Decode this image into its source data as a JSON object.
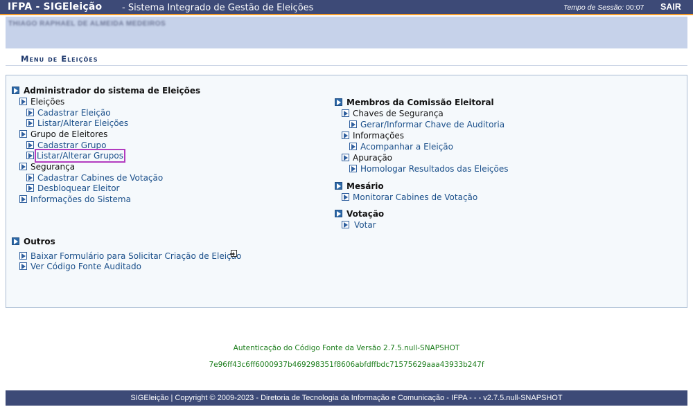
{
  "header": {
    "system_name": "IFPA - SIGEleição",
    "subtitle": "- Sistema Integrado de Gestão de Eleições",
    "session_label": "Tempo de Sessão:",
    "session_time": "00:07",
    "logout_label": "SAIR"
  },
  "user": {
    "name": "THIAGO RAPHAEL DE ALMEIDA MEDEIROS"
  },
  "menu_title": "Menu de Eleições",
  "left_col": {
    "admin": {
      "title": "Administrador do sistema de Eleições",
      "eleicoes": {
        "label": "Eleições",
        "items": [
          "Cadastrar Eleição",
          "Listar/Alterar Eleições"
        ]
      },
      "grupo": {
        "label": "Grupo de Eleitores",
        "items": [
          "Cadastrar Grupo",
          "Listar/Alterar Grupos"
        ]
      },
      "seguranca": {
        "label": "Segurança",
        "items": [
          "Cadastrar Cabines de Votação",
          "Desbloquear Eleitor"
        ]
      },
      "info": "Informações do Sistema"
    },
    "outros": {
      "title": "Outros",
      "items": [
        "Baixar Formulário para Solicitar Criação de Eleição",
        "Ver Código Fonte Auditado"
      ]
    }
  },
  "right_col": {
    "comissao": {
      "title": "Membros da Comissão Eleitoral",
      "chaves": {
        "label": "Chaves de Segurança",
        "items": [
          "Gerar/Informar Chave de Auditoria"
        ]
      },
      "informacoes": {
        "label": "Informações",
        "items": [
          "Acompanhar a Eleição"
        ]
      },
      "apuracao": {
        "label": "Apuração",
        "items": [
          "Homologar Resultados das Eleições"
        ]
      }
    },
    "mesario": {
      "title": "Mesário",
      "items": [
        "Monitorar Cabines de Votação"
      ]
    },
    "votacao": {
      "title": "Votação",
      "items": [
        "Votar"
      ]
    }
  },
  "auth": {
    "line1": "Autenticação do Código Fonte da Versão 2.7.5.null-SNAPSHOT",
    "hash": "7e96ff43c6ff6000937b469298351f8606abfdffbdc71575629aaa43933b247f"
  },
  "footer": "SIGEleição | Copyright © 2009-2023 - Diretoria de Tecnologia da Informação e Comunicação - IFPA - - - v2.7.5.null-SNAPSHOT",
  "colors": {
    "header_bg": "#3d4a77",
    "accent": "#f39c2b",
    "link": "#1a4f8a",
    "auth_green": "#1b7d1b",
    "highlight": "#b23bbf"
  }
}
